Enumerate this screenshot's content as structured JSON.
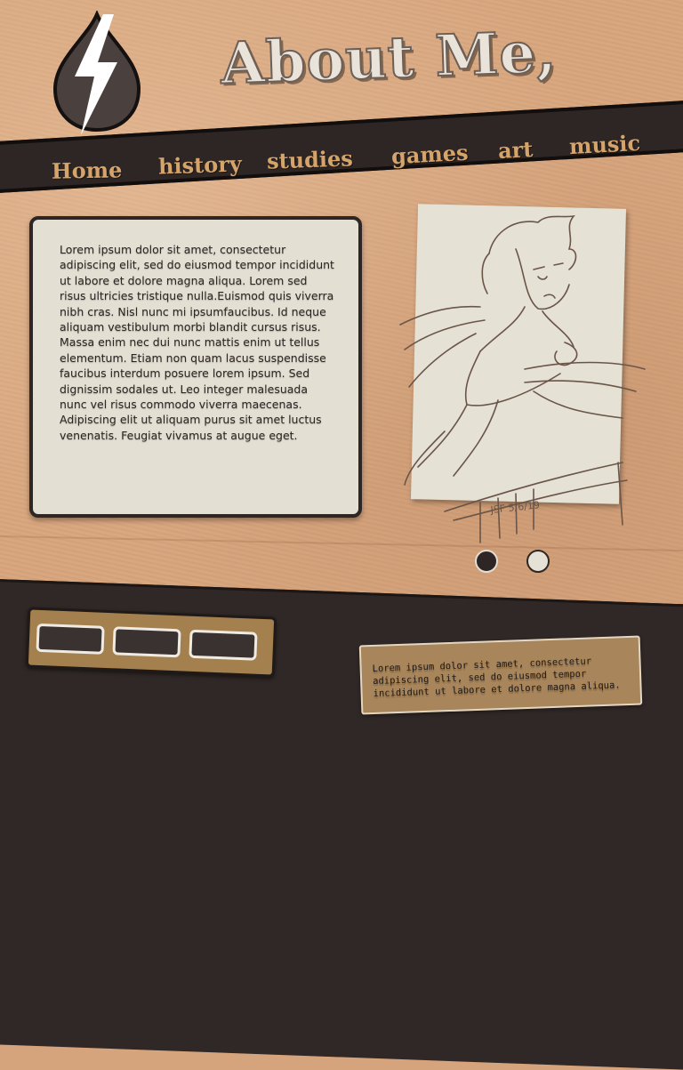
{
  "header": {
    "logo_icon": "lightning-bolt-drop-icon",
    "title": "About Me,"
  },
  "nav": {
    "items": [
      {
        "label": "Home"
      },
      {
        "label": "history"
      },
      {
        "label": "studies"
      },
      {
        "label": "games"
      },
      {
        "label": "art"
      },
      {
        "label": "music"
      }
    ]
  },
  "about": {
    "text": "Lorem ipsum dolor sit amet, consectetur adipiscing elit, sed do eiusmod tempor incididunt ut labore et dolore magna aliqua. Lorem sed risus ultricies tristique nulla.Euismod quis viverra nibh cras. Nisl nunc mi ipsumfaucibus. Id neque aliquam vestibulum morbi blandit cursus risus. Massa enim nec dui nunc mattis enim ut tellus elementum. Etiam non quam lacus suspendisse faucibus interdum posuere lorem ipsum. Sed dignissim sodales ut. Leo integer malesuada nunc vel risus commodo viverra maecenas. Adipiscing elit ut aliquam purus sit amet luctus venenatis. Feugiat vivamus at augue eget."
  },
  "gallery": {
    "sketch_signature": "JSF 5/6/19",
    "dots": [
      {
        "active": true
      },
      {
        "active": false
      }
    ]
  },
  "footer": {
    "note": "Lorem ipsum dolor sit amet, consectetur adipiscing elit, sed do eiusmod tempor incididunt ut labore et dolore magna aliqua."
  },
  "colors": {
    "paper": "#d7a57d",
    "dark": "#302826",
    "nav_text": "#d4a46a",
    "card": "#e4dfd3",
    "tray": "#a4804f",
    "note": "#a8855a"
  }
}
